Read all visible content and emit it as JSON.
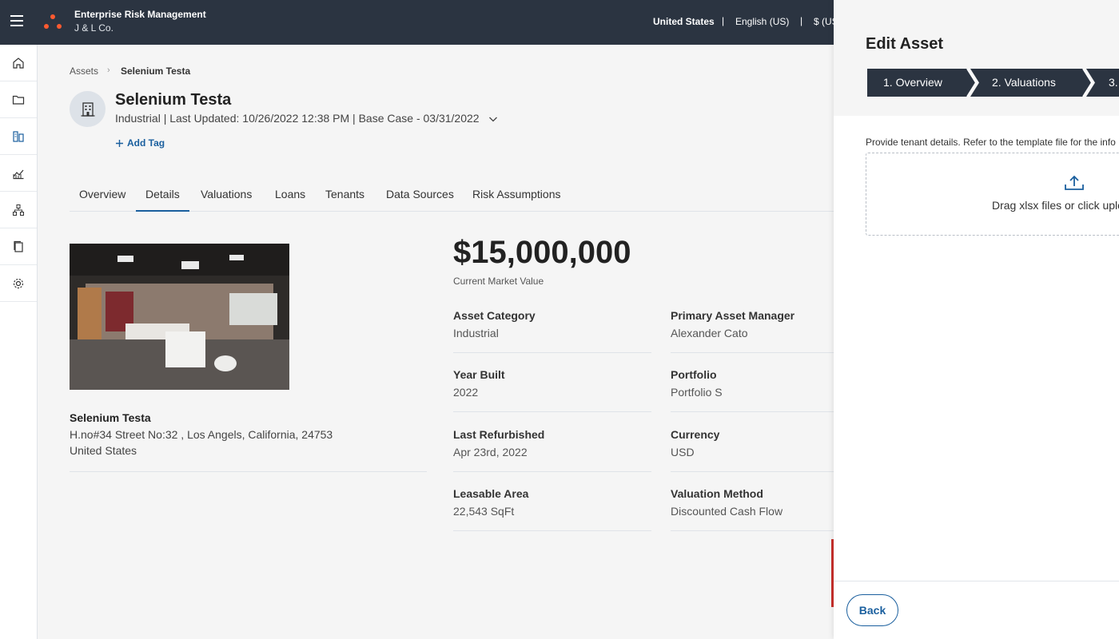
{
  "header": {
    "app_title": "Enterprise Risk Management",
    "org": "J & L Co.",
    "country": "United States",
    "language": "English (US)",
    "currency": "$ (US",
    "separator": "|"
  },
  "rail": {
    "items": [
      "home-icon",
      "folder-icon",
      "assets-icon",
      "chart-icon",
      "hierarchy-icon",
      "copy-icon",
      "settings-icon"
    ],
    "active_color": "#1a5f9e"
  },
  "breadcrumb": {
    "root": "Assets",
    "separator": "›",
    "current": "Selenium Testa"
  },
  "asset": {
    "name": "Selenium Testa",
    "meta": "Industrial | Last Updated: 10/26/2022 12:38 PM | Base Case - 03/31/2022",
    "add_tag": "Add Tag"
  },
  "tabs": [
    "Overview",
    "Details",
    "Valuations",
    "Loans",
    "Tenants",
    "Data Sources",
    "Risk Assumptions"
  ],
  "active_tab": "Details",
  "location": {
    "name": "Selenium Testa",
    "address": "H.no#34 Street No:32 , Los Angels, California, 24753",
    "country": "United States"
  },
  "market_value": {
    "value": "$15,000,000",
    "label": "Current Market Value"
  },
  "fields": [
    {
      "label": "Asset Category",
      "value": "Industrial"
    },
    {
      "label": "Primary Asset Manager",
      "value": "Alexander Cato"
    },
    {
      "label": "Year Built",
      "value": "2022"
    },
    {
      "label": "Portfolio",
      "value": "Portfolio S"
    },
    {
      "label": "Last Refurbished",
      "value": "Apr 23rd, 2022"
    },
    {
      "label": "Currency",
      "value": "USD"
    },
    {
      "label": "Leasable Area",
      "value": "22,543 SqFt"
    },
    {
      "label": "Valuation Method",
      "value": "Discounted Cash Flow"
    }
  ],
  "panel": {
    "title": "Edit Asset",
    "steps": [
      "1. Overview",
      "2. Valuations",
      "3."
    ],
    "hint": "Provide tenant details. Refer to the template file for the info",
    "dropzone_text": "Drag xlsx files or click uplo",
    "back_label": "Back"
  },
  "colors": {
    "topbar": "#2b3441",
    "accent": "#1a5f9e",
    "step_bg": "#2b3441",
    "logo_dot": "#ff5a30"
  }
}
